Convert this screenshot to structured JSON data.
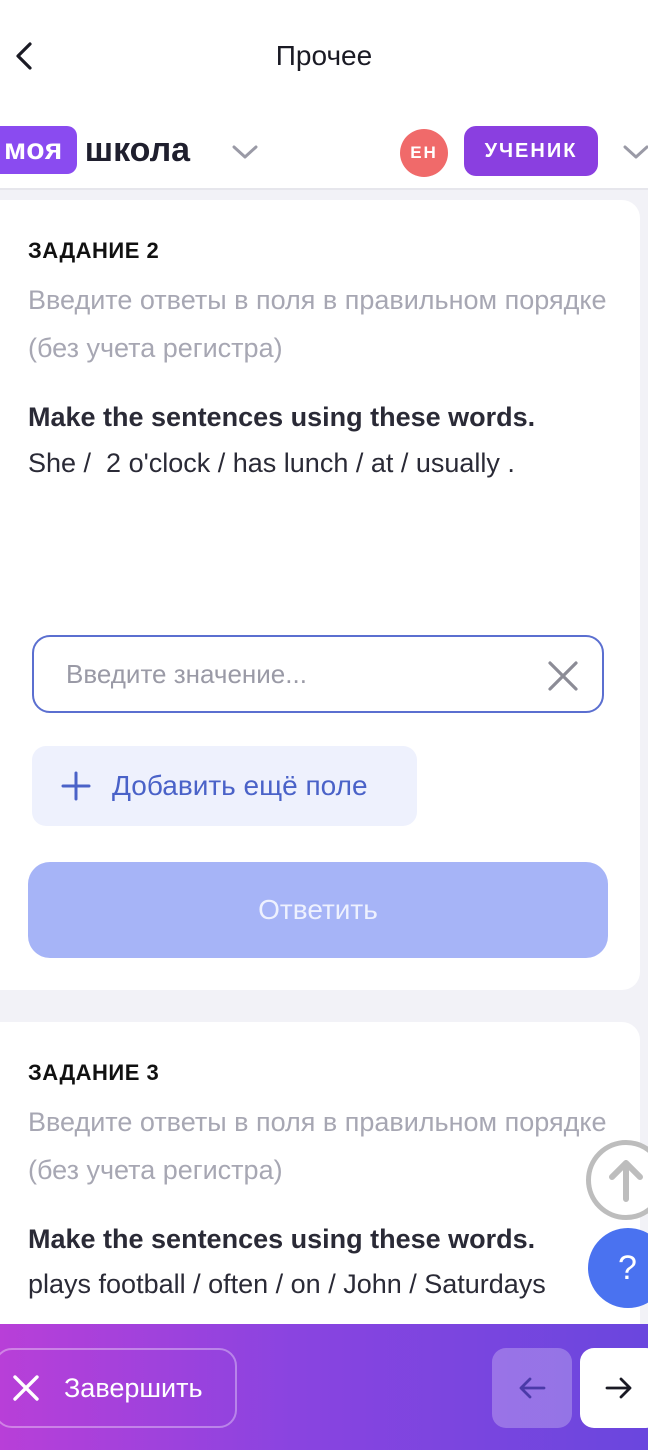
{
  "header": {
    "title": "Прочее"
  },
  "brand": {
    "logo_highlight": "моя",
    "logo_text": "школа",
    "language": "EH",
    "role": "УЧЕНИК"
  },
  "tasks": [
    {
      "title": "ЗАДАНИЕ 2",
      "hint": "Введите ответы в поля в правильном порядке (без учета регистра)",
      "prompt": "Make the sentences using these words.",
      "words": "She /  2 o'clock / has lunch / at / usually ."
    },
    {
      "title": "ЗАДАНИЕ 3",
      "hint": "Введите ответы в поля в правильном порядке (без учета регистра)",
      "prompt": "Make the sentences using these words.",
      "words": "plays football / often / on / John / Saturdays"
    }
  ],
  "answer": {
    "placeholder": "Введите значение...",
    "value": ""
  },
  "actions": {
    "add_field": "Добавить ещё поле",
    "submit": "Ответить",
    "help": "?"
  },
  "footer": {
    "finish": "Завершить"
  },
  "colors": {
    "accent": "#8a4bf0",
    "primary_blue": "#4a72f0",
    "submit_disabled": "#a6b4f7",
    "lang_badge": "#f06a6a"
  }
}
